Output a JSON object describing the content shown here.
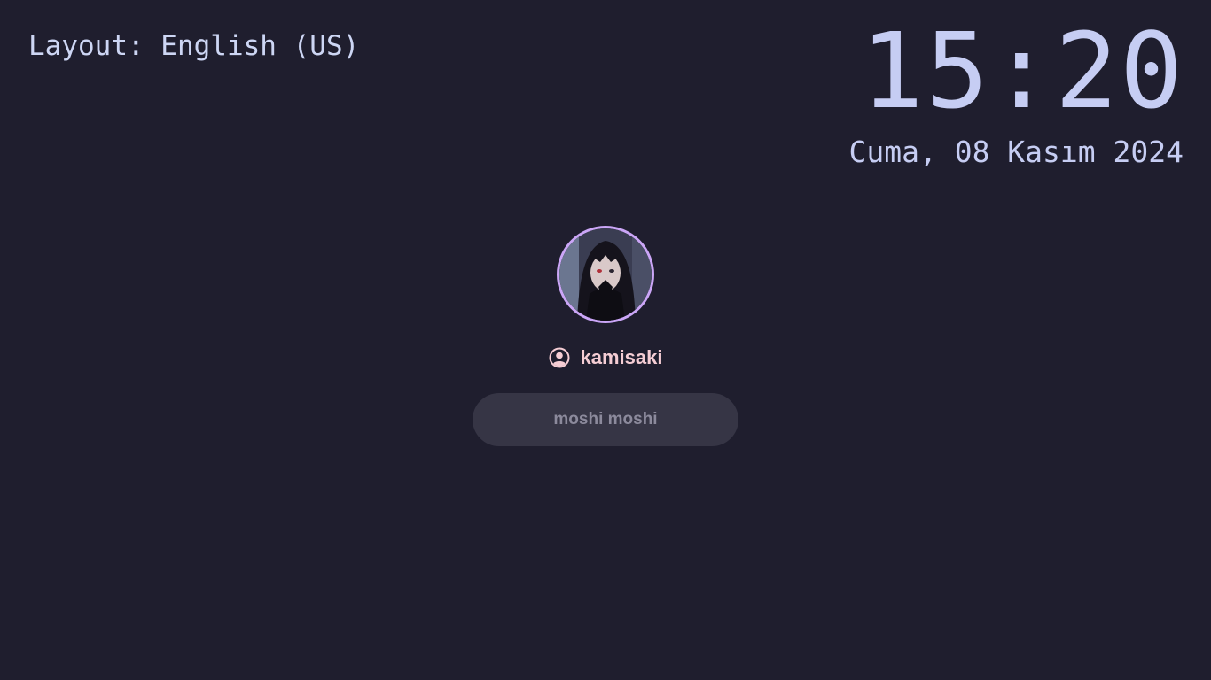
{
  "keyboard": {
    "layout_label": "Layout: English (US)"
  },
  "clock": {
    "time": "15:20",
    "date": "Cuma, 08 Kasım 2024"
  },
  "user": {
    "avatar_icon": "user-avatar-image",
    "user_icon": "user-circle-icon",
    "username": "kamisaki"
  },
  "password": {
    "placeholder": "moshi moshi",
    "value": ""
  },
  "colors": {
    "background": "#1f1e2e",
    "text_primary": "#cdd6f4",
    "accent_border": "#cba6f7",
    "username": "#f5cdd4",
    "input_background": "#363545",
    "input_placeholder": "#8c8a9c"
  }
}
